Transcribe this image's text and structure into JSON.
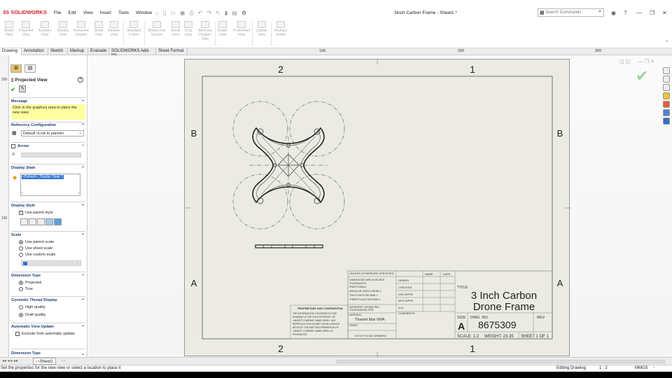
{
  "app": {
    "logo": "SOLIDWORKS",
    "doc_title": "3inch Carbon Frame - Sheet1 *"
  },
  "menu": [
    "File",
    "Edit",
    "View",
    "Insert",
    "Tools",
    "Window"
  ],
  "search": {
    "placeholder": "Search Commands"
  },
  "ribbon": [
    {
      "label": "Model\nView"
    },
    {
      "label": "Projected\nView"
    },
    {
      "label": "Auxiliary\nView"
    },
    {
      "label": "Section\nView"
    },
    {
      "label": "Removed\nSection"
    },
    {
      "label": "Detail\nView"
    },
    {
      "label": "Relative\nView"
    },
    {
      "label": "Standard\n3 View"
    },
    {
      "label": "Broken-out\nSection"
    },
    {
      "label": "Break\nView"
    },
    {
      "label": "Crop\nView"
    },
    {
      "label": "Alternate\nPosition\nView"
    },
    {
      "label": "Empty\nView"
    },
    {
      "label": "Predefined\nView"
    },
    {
      "label": "Update\nView"
    },
    {
      "label": "Replace\nModel"
    }
  ],
  "tabs": [
    "Drawing",
    "Annotation",
    "Sketch",
    "Markup",
    "Evaluate",
    "SOLIDWORKS Add-Ins",
    "Sheet Format"
  ],
  "ruler": [
    "100",
    "200",
    "300"
  ],
  "left_ruler": [
    "200",
    "100"
  ],
  "pm": {
    "title": "Projected View",
    "help": "?",
    "message_header": "Message",
    "message": "Click in the graphics area to place the new view.",
    "refconfig_header": "Reference Configuration",
    "refconfig_value": "Default <Link to parent>",
    "arrow_header": "Arrow",
    "arrow_letter": "A",
    "display_state_header": "Display State",
    "display_state_value": "<Default>_Display State 1",
    "display_style_header": "Display Style",
    "use_parent_style": "Use parent style",
    "scale_header": "Scale",
    "scale_options": [
      "Use parent scale",
      "Use sheet scale",
      "Use custom scale"
    ],
    "dimension_type_header": "Dimension Type",
    "dimension_options": [
      "Projected",
      "True"
    ],
    "cosmetic_header": "Cosmetic Thread Display",
    "cosmetic_options": [
      "High quality",
      "Draft quality"
    ],
    "auto_update_header": "Automatic View Update",
    "exclude_label": "Exclude from automatic update",
    "dimension_type_footer": "Dimension Type"
  },
  "sheet": {
    "zone_cols": [
      "2",
      "1"
    ],
    "zone_rows": [
      "B",
      "A"
    ],
    "tb": {
      "unless": "UNLESS OTHERWISE SPECIFIED:",
      "name": "NAME",
      "date": "DATE",
      "dims_lines": [
        "DIMENSIONS ARE IN INCHES",
        "TOLERANCES:",
        "FRACTIONAL±",
        "ANGULAR: MACH±   BEND ±",
        "TWO PLACE DECIMAL   ±",
        "THREE PLACE DECIMAL  ±"
      ],
      "interpret": [
        "INTERPRET GEOMETRIC",
        "TOLERANCING PER:"
      ],
      "material_label": "MATERIAL",
      "material": "Thamel Mat VMA",
      "finish": "FINISH",
      "do_not_scale": "DO NOT SCALE DRAWING",
      "roles": [
        "DRAWN",
        "CHECKED",
        "ENG APPR.",
        "MFG APPR.",
        "Q.A.",
        "COMMENTS:"
      ],
      "title_label": "TITLE:",
      "title_line1": "3 Inch Carbon",
      "title_line2": "Drone Frame",
      "size_label": "SIZE",
      "size": "A",
      "dwg_label": "DWG.  NO.",
      "dwg_no": "8675309",
      "rev": "REV",
      "scale": "SCALE: 1:2",
      "weight": "WEIGHT: 23.35",
      "sheet_of": "SHEET 1 OF 1",
      "prop_title": "PROPRIETARY AND CONFIDENTIAL",
      "prop_text": [
        "THE INFORMATION CONTAINED IN THIS",
        "DRAWING IS THE SOLE PROPERTY OF",
        "<INSERT COMPANY NAME HERE>. ANY",
        "REPRODUCTION IN PART OR AS A WHOLE",
        "WITHOUT THE WRITTEN PERMISSION OF",
        "<INSERT COMPANY NAME HERE> IS",
        "PROHIBITED."
      ]
    }
  },
  "sheet_tab": "Sheet1",
  "status": {
    "message": "Set the properties for the new view or select a location to place it",
    "mode": "Editing Drawing",
    "scale": "1 : 2",
    "units": "MMGS"
  }
}
